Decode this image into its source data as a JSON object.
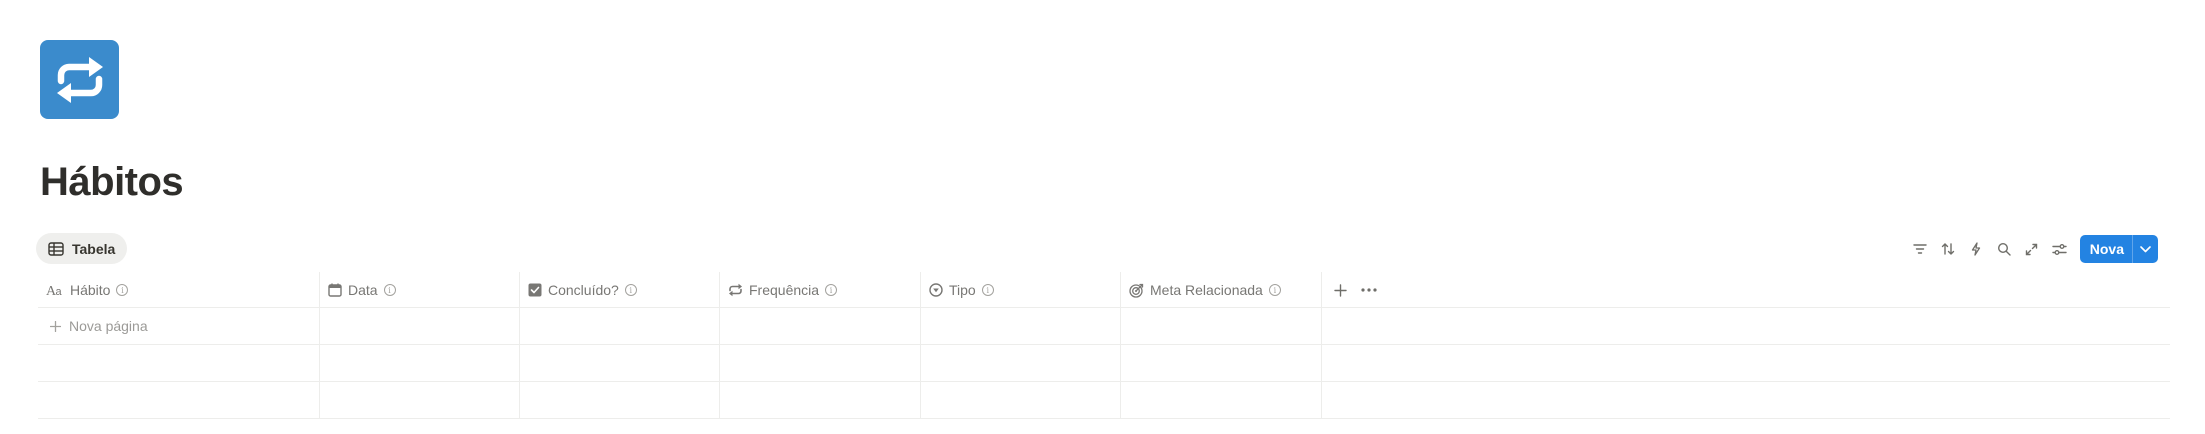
{
  "page": {
    "icon": "sync-arrows-icon",
    "title": "Hábitos"
  },
  "view": {
    "tab_icon": "table-icon",
    "tab_label": "Tabela"
  },
  "toolbar": {
    "icons": [
      "filter-icon",
      "sort-icon",
      "lightning-icon",
      "search-icon",
      "expand-icon",
      "settings-sliders-icon"
    ],
    "new_label": "Nova"
  },
  "table": {
    "columns": [
      {
        "icon": "title-aa-icon",
        "label": "Hábito"
      },
      {
        "icon": "calendar-icon",
        "label": "Data"
      },
      {
        "icon": "checkbox-icon",
        "label": "Concluído?"
      },
      {
        "icon": "repeat-icon",
        "label": "Frequência"
      },
      {
        "icon": "select-icon",
        "label": "Tipo"
      },
      {
        "icon": "target-icon",
        "label": "Meta Relacionada"
      }
    ],
    "new_page_label": "Nova página"
  },
  "colors": {
    "accent": "#2383e2",
    "icon_bg": "#3b8bcc",
    "text": "#37352f",
    "muted": "#787774",
    "border": "#ededeb"
  }
}
